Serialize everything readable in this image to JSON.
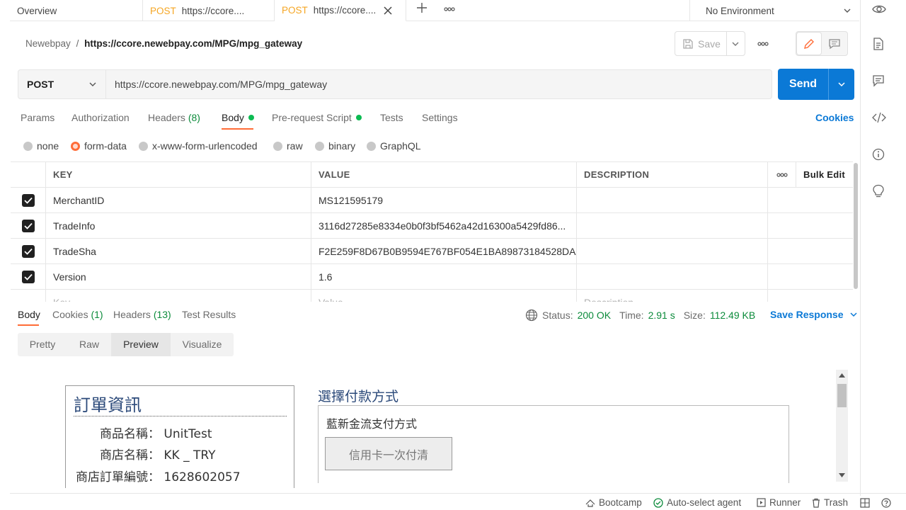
{
  "tabs": [
    {
      "label": "Overview",
      "method": ""
    },
    {
      "label": "https://ccore....",
      "method": "POST"
    },
    {
      "label": "https://ccore....",
      "method": "POST"
    }
  ],
  "environment": "No Environment",
  "breadcrumb": {
    "workspace": "Newebpay",
    "separator": "/",
    "current": "https://ccore.newebpay.com/MPG/mpg_gateway"
  },
  "header": {
    "save_label": "Save"
  },
  "request": {
    "method": "POST",
    "url": "https://ccore.newebpay.com/MPG/mpg_gateway",
    "send_label": "Send"
  },
  "request_tabs": {
    "params": "Params",
    "authorization": "Authorization",
    "headers": "Headers",
    "headers_count": "(8)",
    "body": "Body",
    "prerequest": "Pre-request Script",
    "tests": "Tests",
    "settings": "Settings",
    "cookies": "Cookies"
  },
  "body_types": {
    "none": "none",
    "form_data": "form-data",
    "urlencoded": "x-www-form-urlencoded",
    "raw": "raw",
    "binary": "binary",
    "graphql": "GraphQL"
  },
  "table": {
    "headers": {
      "key": "KEY",
      "value": "VALUE",
      "description": "DESCRIPTION",
      "bulk_edit": "Bulk Edit"
    },
    "rows": [
      {
        "key": "MerchantID",
        "value": "MS121595179",
        "description": ""
      },
      {
        "key": "TradeInfo",
        "value": "3116d27285e8334e0b0f3bf5462a42d16300a5429fd86...",
        "description": ""
      },
      {
        "key": "TradeSha",
        "value": "F2E259F8D67B0B9594E767BF054E1BA89873184528DA...",
        "description": ""
      },
      {
        "key": "Version",
        "value": "1.6",
        "description": ""
      }
    ],
    "placeholder": {
      "key": "Key",
      "value": "Value",
      "description": "Description"
    }
  },
  "response_tabs": {
    "body": "Body",
    "cookies": "Cookies",
    "cookies_count": "(1)",
    "headers": "Headers",
    "headers_count": "(13)",
    "test_results": "Test Results"
  },
  "response_status": {
    "status_label": "Status:",
    "status_value": "200 OK",
    "time_label": "Time:",
    "time_value": "2.91 s",
    "size_label": "Size:",
    "size_value": "112.49 KB",
    "save_response": "Save Response"
  },
  "view_modes": {
    "pretty": "Pretty",
    "raw": "Raw",
    "preview": "Preview",
    "visualize": "Visualize"
  },
  "preview": {
    "order_title": "訂單資訊",
    "order_lines": [
      {
        "label": "商品名稱：",
        "value": "UnitTest"
      },
      {
        "label": "商店名稱：",
        "value": "KK _ TRY"
      },
      {
        "label": "商店訂單編號：",
        "value": "1628602057"
      }
    ],
    "pay_title": "選擇付款方式",
    "pay_subtitle": "藍新金流支付方式",
    "pay_button": "信用卡一次付清"
  },
  "footer": {
    "bootcamp": "Bootcamp",
    "agent": "Auto-select agent",
    "runner": "Runner",
    "trash": "Trash"
  },
  "colors": {
    "accent": "#ff6c37",
    "send": "#0b79d6",
    "success": "#0c8b3b"
  }
}
